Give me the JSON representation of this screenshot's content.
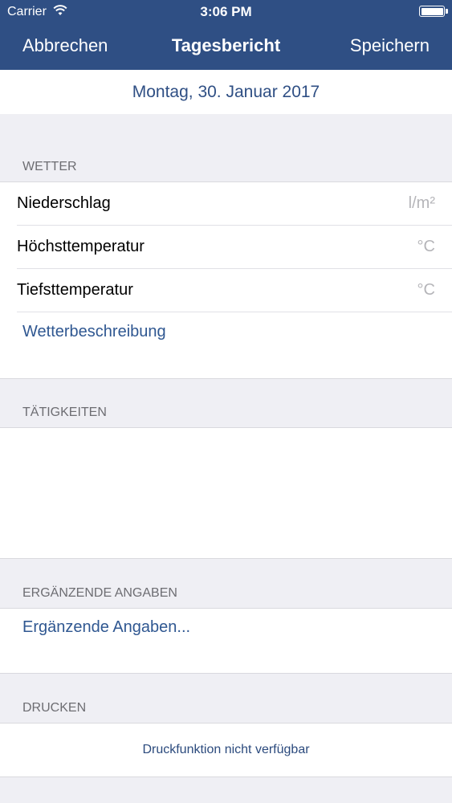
{
  "status_bar": {
    "carrier": "Carrier",
    "time": "3:06 PM",
    "wifi_icon": "wifi-icon",
    "battery_icon": "battery-icon"
  },
  "nav": {
    "left_button": "Abbrechen",
    "title": "Tagesbericht",
    "right_button": "Speichern",
    "bar_color": "#2f4f84"
  },
  "date": "Montag, 30. Januar 2017",
  "weather": {
    "header": "WETTER",
    "rows": [
      {
        "label": "Niederschlag",
        "unit": "l/m²"
      },
      {
        "label": "Höchsttemperatur",
        "unit": "°C"
      },
      {
        "label": "Tiefsttemperatur",
        "unit": "°C"
      }
    ],
    "description_link": "Wetterbeschreibung"
  },
  "activities": {
    "header": "TÄTIGKEITEN"
  },
  "supplementary": {
    "header": "ERGÄNZENDE ANGABEN",
    "link": "Ergänzende Angaben..."
  },
  "print": {
    "header": "DRUCKEN",
    "note": "Druckfunktion nicht verfügbar"
  },
  "colors": {
    "accent": "#2f4f84",
    "background": "#efeff4"
  }
}
